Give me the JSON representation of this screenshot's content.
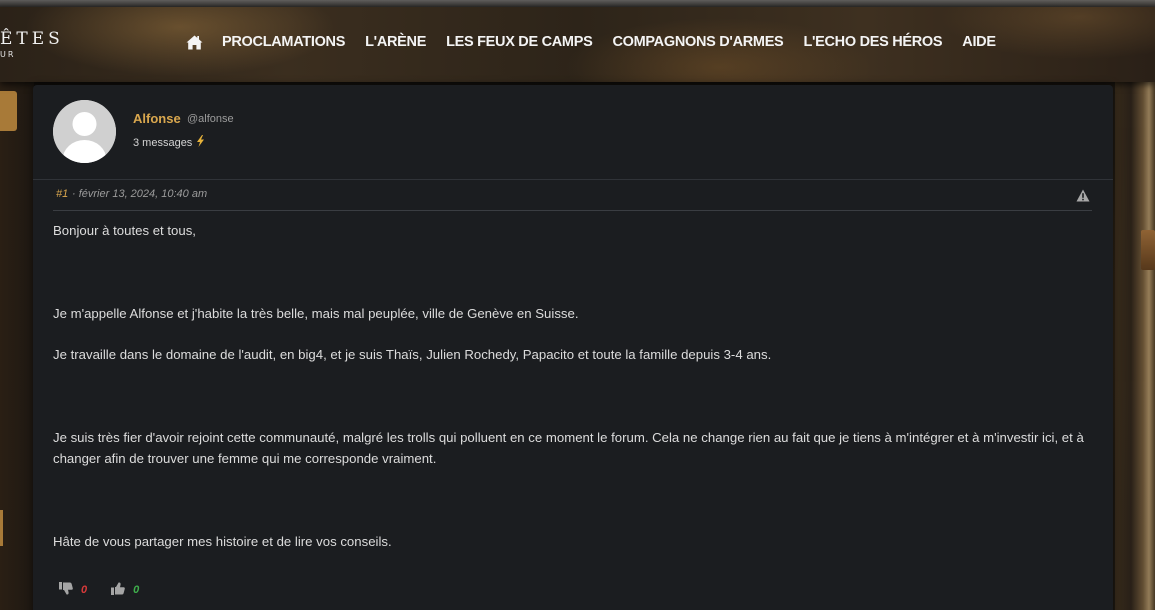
{
  "header": {
    "logo_text": "ÊTES",
    "logo_sub": "UR",
    "nav": {
      "home_icon": "home-icon",
      "items": [
        {
          "label": "PROCLAMATIONS"
        },
        {
          "label": "L'ARÈNE"
        },
        {
          "label": "LES FEUX DE CAMPS"
        },
        {
          "label": "COMPAGNONS D'ARMES"
        },
        {
          "label": "L'ECHO DES HÉROS"
        },
        {
          "label": "AIDE"
        }
      ]
    }
  },
  "post": {
    "author": {
      "name": "Alfonse",
      "handle": "@alfonse",
      "messages": "3 messages",
      "badge_icon": "lightning-icon"
    },
    "number": "#1",
    "date": "· février 13, 2024, 10:40 am",
    "report_icon": "warning-icon",
    "paragraphs": [
      "Bonjour à toutes et tous,",
      "Je m'appelle Alfonse et j'habite la très belle, mais mal peuplée, ville de Genève en Suisse.",
      "Je travaille dans le domaine de l'audit, en big4, et je suis Thaïs, Julien Rochedy, Papacito et toute la famille depuis 3-4 ans.",
      "Je suis très fier d'avoir rejoint cette communauté, malgré les trolls qui polluent en ce moment le forum. Cela ne change rien au fait que je tiens à m'intégrer et à m'investir ici, et à changer afin de trouver une femme qui me corresponde vraiment.",
      "Hâte de vous partager mes histoire et de lire vos conseils."
    ],
    "reactions": {
      "dislikes": "0",
      "likes": "0"
    }
  },
  "colors": {
    "accent": "#d9a74e",
    "dislike": "#d83a3a",
    "like": "#3fae4c",
    "card_bg": "#1b1d20"
  }
}
